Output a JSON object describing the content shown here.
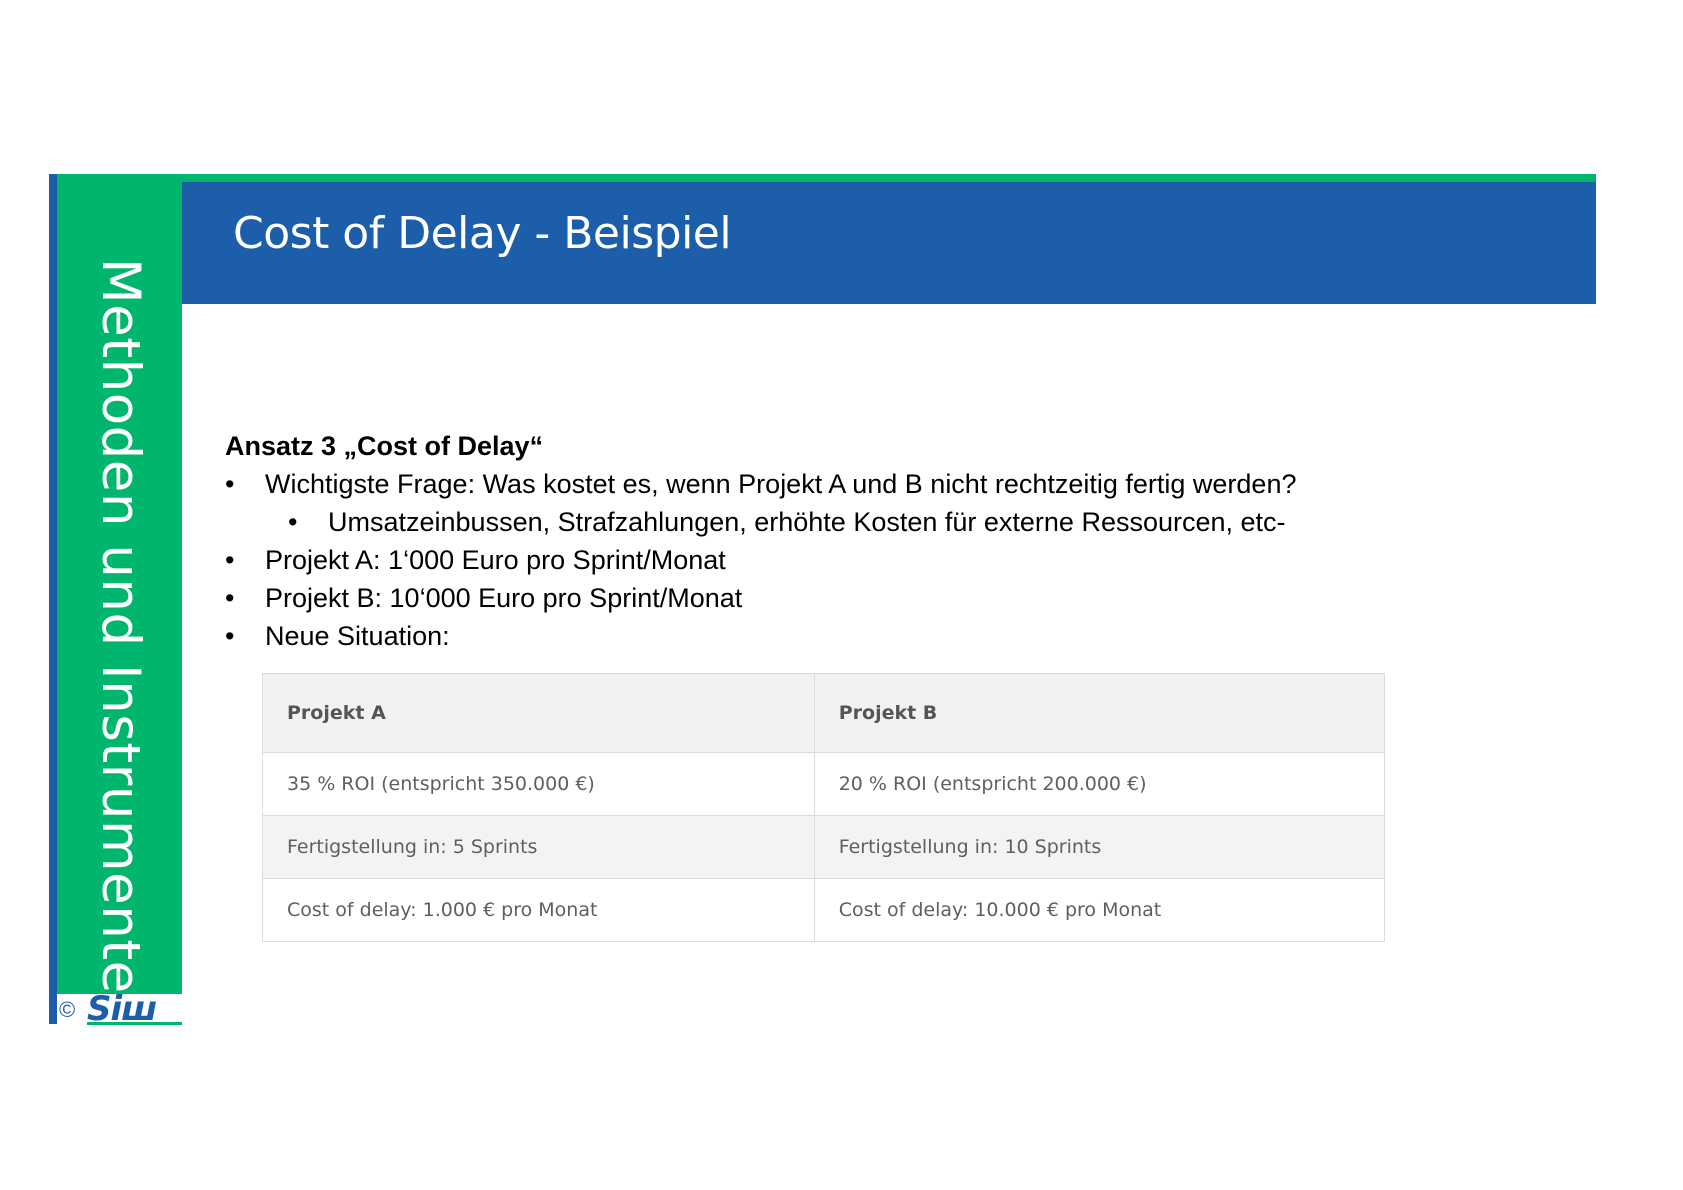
{
  "sidebar": {
    "label": "Methoden und Instrumente"
  },
  "logo": {
    "copyright": "©",
    "brand": "SIW"
  },
  "header": {
    "title": "Cost of Delay - Beispiel"
  },
  "content": {
    "heading": "Ansatz 3 „Cost of Delay“",
    "bullets": [
      "Wichtigste Frage: Was kostet es, wenn Projekt A und B nicht rechtzeitig fertig werden?",
      "Umsatzeinbussen, Strafzahlungen, erhöhte Kosten für externe Ressourcen, etc-",
      "Projekt A: 1‘000 Euro pro Sprint/Monat",
      "Projekt B: 10‘000 Euro pro Sprint/Monat",
      "Neue Situation:"
    ],
    "bullet_glyph": "•"
  },
  "table": {
    "headers": [
      "Projekt A",
      "Projekt B"
    ],
    "rows": [
      [
        "35 % ROI (entspricht 350.000 €)",
        "20 % ROI (entspricht 200.000 €)"
      ],
      [
        "Fertigstellung in: 5 Sprints",
        "Fertigstellung in: 10 Sprints"
      ],
      [
        "Cost of delay: 1.000 € pro Monat",
        "Cost of delay: 10.000 € pro Monat"
      ]
    ]
  },
  "colors": {
    "blue": "#1c5ea9",
    "green": "#00b66c"
  }
}
